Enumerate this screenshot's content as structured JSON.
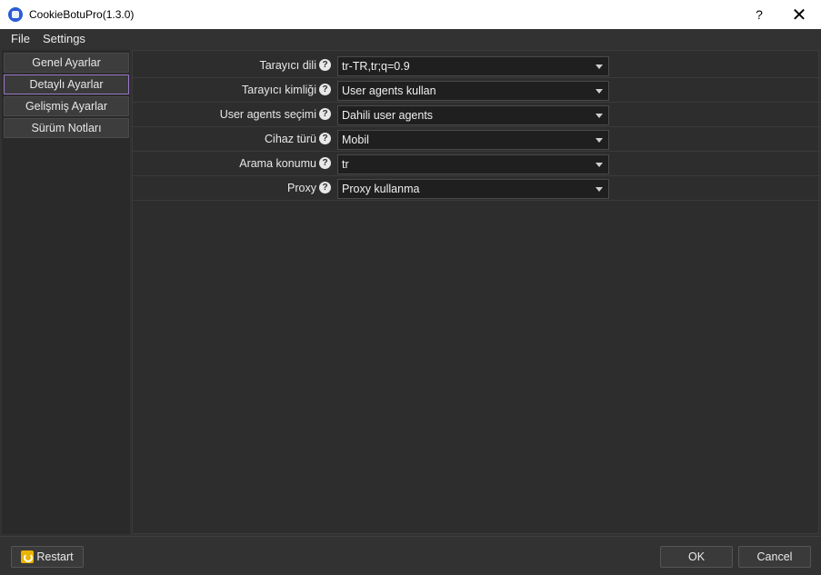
{
  "window": {
    "title": "CookieBotuPro(1.3.0)",
    "help_glyph": "?",
    "close_glyph": "✕"
  },
  "menu": [
    "File",
    "Settings"
  ],
  "sidebar": {
    "items": [
      {
        "label": "Genel Ayarlar",
        "active": false
      },
      {
        "label": "Detaylı Ayarlar",
        "active": true
      },
      {
        "label": "Gelişmiş Ayarlar",
        "active": false
      },
      {
        "label": "Sürüm Notları",
        "active": false
      }
    ]
  },
  "form": {
    "help_glyph": "?",
    "rows": [
      {
        "label": "Tarayıcı dili",
        "value": "tr-TR,tr;q=0.9"
      },
      {
        "label": "Tarayıcı kimliği",
        "value": "User agents kullan"
      },
      {
        "label": "User agents seçimi",
        "value": "Dahili user agents"
      },
      {
        "label": "Cihaz türü",
        "value": "Mobil"
      },
      {
        "label": "Arama konumu",
        "value": "tr"
      },
      {
        "label": "Proxy",
        "value": "Proxy kullanma"
      }
    ]
  },
  "footer": {
    "restart_label": "Restart",
    "ok_label": "OK",
    "cancel_label": "Cancel"
  },
  "colors": {
    "accent": "#9a78c8",
    "background": "#2d2d2d"
  }
}
